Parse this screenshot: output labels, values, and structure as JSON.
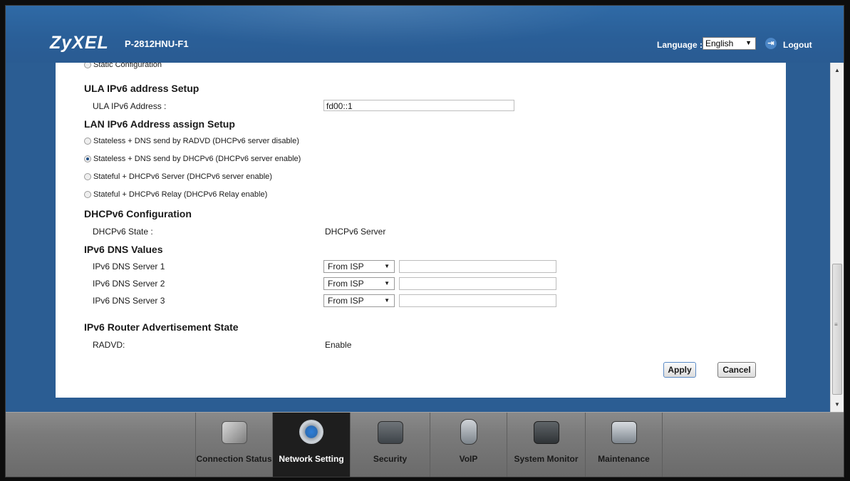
{
  "header": {
    "logo": "ZyXEL",
    "model": "P-2812HNU-F1",
    "language_label": "Language :",
    "language_value": "English",
    "logout": "Logout"
  },
  "content": {
    "top_partial": "Static Configuration",
    "ula": {
      "title": "ULA IPv6 address Setup",
      "address_label": "ULA IPv6 Address :",
      "address_value": "fd00::1"
    },
    "lan": {
      "title": "LAN IPv6 Address assign Setup",
      "options": [
        {
          "label": "Stateless + DNS send by RADVD (DHCPv6 server disable)",
          "selected": false
        },
        {
          "label": "Stateless + DNS send by DHCPv6 (DHCPv6 server enable)",
          "selected": true
        },
        {
          "label": "Stateful + DHCPv6 Server (DHCPv6 server enable)",
          "selected": false
        },
        {
          "label": "Stateful + DHCPv6 Relay (DHCPv6 Relay enable)",
          "selected": false
        }
      ]
    },
    "dhcpv6": {
      "title": "DHCPv6 Configuration",
      "state_label": "DHCPv6 State :",
      "state_value": "DHCPv6 Server"
    },
    "dns": {
      "title": "IPv6 DNS Values",
      "servers": [
        {
          "label": "IPv6 DNS Server 1",
          "mode": "From ISP",
          "value": ""
        },
        {
          "label": "IPv6 DNS Server 2",
          "mode": "From ISP",
          "value": ""
        },
        {
          "label": "IPv6 DNS Server 3",
          "mode": "From ISP",
          "value": ""
        }
      ]
    },
    "router_adv": {
      "title": "IPv6 Router Advertisement State",
      "radvd_label": "RADVD:",
      "radvd_value": "Enable"
    },
    "buttons": {
      "apply": "Apply",
      "cancel": "Cancel"
    }
  },
  "nav": {
    "items": [
      {
        "label": "Connection Status",
        "icon": "connection-status-icon",
        "active": false
      },
      {
        "label": "Network Setting",
        "icon": "network-setting-icon",
        "active": true
      },
      {
        "label": "Security",
        "icon": "security-icon",
        "active": false
      },
      {
        "label": "VoIP",
        "icon": "voip-icon",
        "active": false
      },
      {
        "label": "System Monitor",
        "icon": "system-monitor-icon",
        "active": false
      },
      {
        "label": "Maintenance",
        "icon": "maintenance-icon",
        "active": false
      }
    ]
  },
  "colors": {
    "header_blue": "#2b5d93",
    "nav_gray": "#7a7a7a",
    "nav_active": "#1e1e1e"
  }
}
